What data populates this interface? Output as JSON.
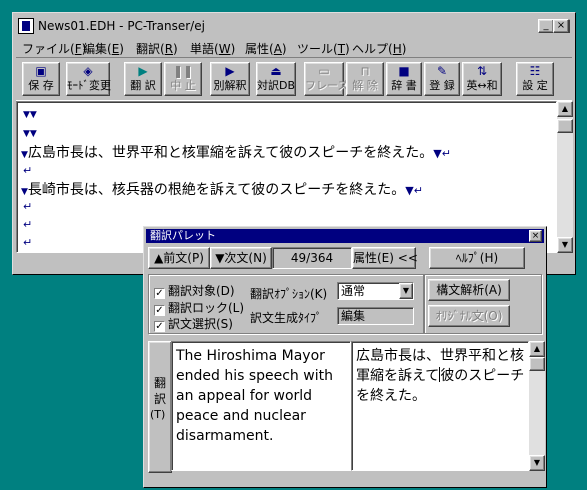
{
  "window": {
    "title": "News01.EDH - PC-Transer/ej",
    "minimize": "_",
    "maximize": "□",
    "close": "×"
  },
  "menu": [
    {
      "label": "ファイル(",
      "key": "F",
      "end": ")"
    },
    {
      "label": "編集(",
      "key": "E",
      "end": ")"
    },
    {
      "label": "翻訳(",
      "key": "R",
      "end": ")"
    },
    {
      "label": "単語(",
      "key": "W",
      "end": ")"
    },
    {
      "label": "属性(",
      "key": "A",
      "end": ")"
    },
    {
      "label": "ツール(",
      "key": "T",
      "end": ")"
    },
    {
      "label": "ヘルプ(",
      "key": "H",
      "end": ")"
    }
  ],
  "toolbar": {
    "save": "保 存",
    "mode_change": "ﾓｰﾄﾞ変更",
    "translate": "翻 訳",
    "stop": "中 止",
    "separate_translation": "別解釈",
    "parallel_db": "対訳DB",
    "phrase": "フレーズ",
    "release": "解 除",
    "dictionary": "辞 書",
    "register": "登 録",
    "en_ja": "英↔和",
    "settings": "設 定"
  },
  "document": {
    "lines": [
      {
        "marks": "▼▼",
        "text": "",
        "ret": ""
      },
      {
        "marks": "▼▼",
        "text": "",
        "ret": ""
      },
      {
        "marks": "▼",
        "text": "広島市長は、世界平和と核軍縮を訴えて彼のスピーチを終えた。",
        "ret": "▼↵"
      },
      {
        "marks": "",
        "text": "",
        "ret": "↵"
      },
      {
        "marks": "▼",
        "text": "長崎市長は、核兵器の根絶を訴えて彼のスピーチを終えた。",
        "ret": "▼↵"
      },
      {
        "marks": "",
        "text": "",
        "ret": "↵"
      },
      {
        "marks": "",
        "text": "",
        "ret": "↵"
      },
      {
        "marks": "",
        "text": "",
        "ret": "↵"
      }
    ]
  },
  "palette": {
    "title": "翻訳パレット",
    "close": "×",
    "prev": "▲前文(P)",
    "next": "▼次文(N)",
    "position": "49/364",
    "attributes": "属性(E) <<",
    "help": "ﾍﾙﾌﾟ(H)",
    "checks": [
      {
        "label": "翻訳対象(D)",
        "checked": true,
        "mark": "✓"
      },
      {
        "label": "翻訳ロック(L)",
        "checked": true,
        "mark": "✓"
      },
      {
        "label": "訳文選択(S)",
        "checked": true,
        "mark": "✓"
      }
    ],
    "option_label": "翻訳ｵﾌﾟｼｮﾝ(K)",
    "option_value": "通常",
    "gen_type_label": "訳文生成ﾀｲﾌﾟ",
    "gen_type_value": "編集",
    "syntax_analysis": "構文解析(A)",
    "original_text": "ｵﾘｼﾞﾅﾙ文(O)",
    "side_label": [
      "翻",
      "訳",
      "(T)"
    ],
    "source_text": "The Hiroshima Mayor ended his speech with an appeal for world peace and nuclear disarmament.",
    "target_text_before": "広島市長は、世界平和と核軍縮を訴えて",
    "target_text_after": "彼のスピーチを終えた。"
  }
}
